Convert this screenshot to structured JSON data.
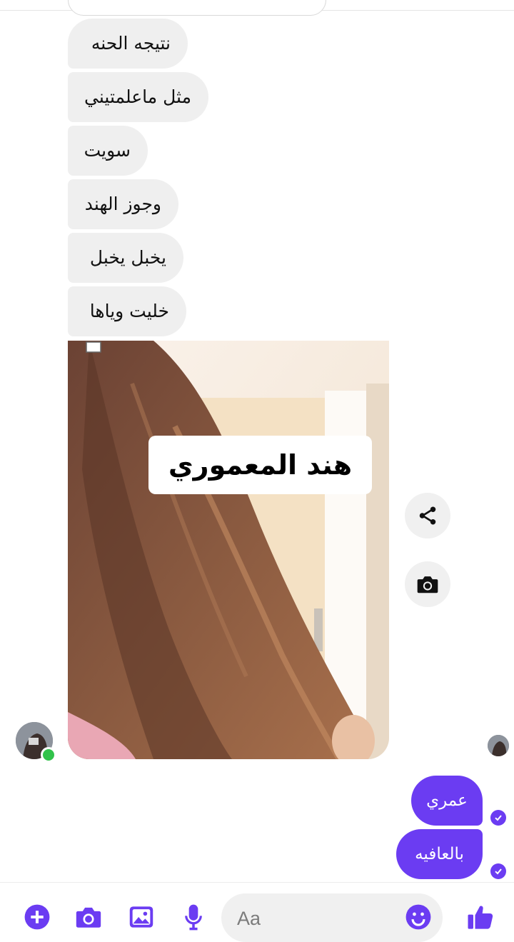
{
  "received_messages": [
    {
      "text": "نتيجه الحنه"
    },
    {
      "text": "مثل ماعلمتيني"
    },
    {
      "text": "سويت"
    },
    {
      "text": "وجوز الهند"
    },
    {
      "text": "يخبل يخبل"
    },
    {
      "text": "خليت وياها"
    }
  ],
  "photo": {
    "caption": "هند المعموري"
  },
  "photo_actions": {
    "share_icon": "share-icon",
    "camera_icon": "camera-icon"
  },
  "sent_messages": [
    {
      "text": "عمري"
    },
    {
      "text": "بالعافيه"
    }
  ],
  "composer": {
    "placeholder": "Aa",
    "icons": [
      "plus-icon",
      "camera-icon",
      "image-icon",
      "microphone-icon",
      "emoji-icon",
      "thumbs-up-icon"
    ]
  },
  "colors": {
    "accent": "#6b3cf2",
    "received_bubble": "#efefef",
    "online": "#31c24a"
  }
}
